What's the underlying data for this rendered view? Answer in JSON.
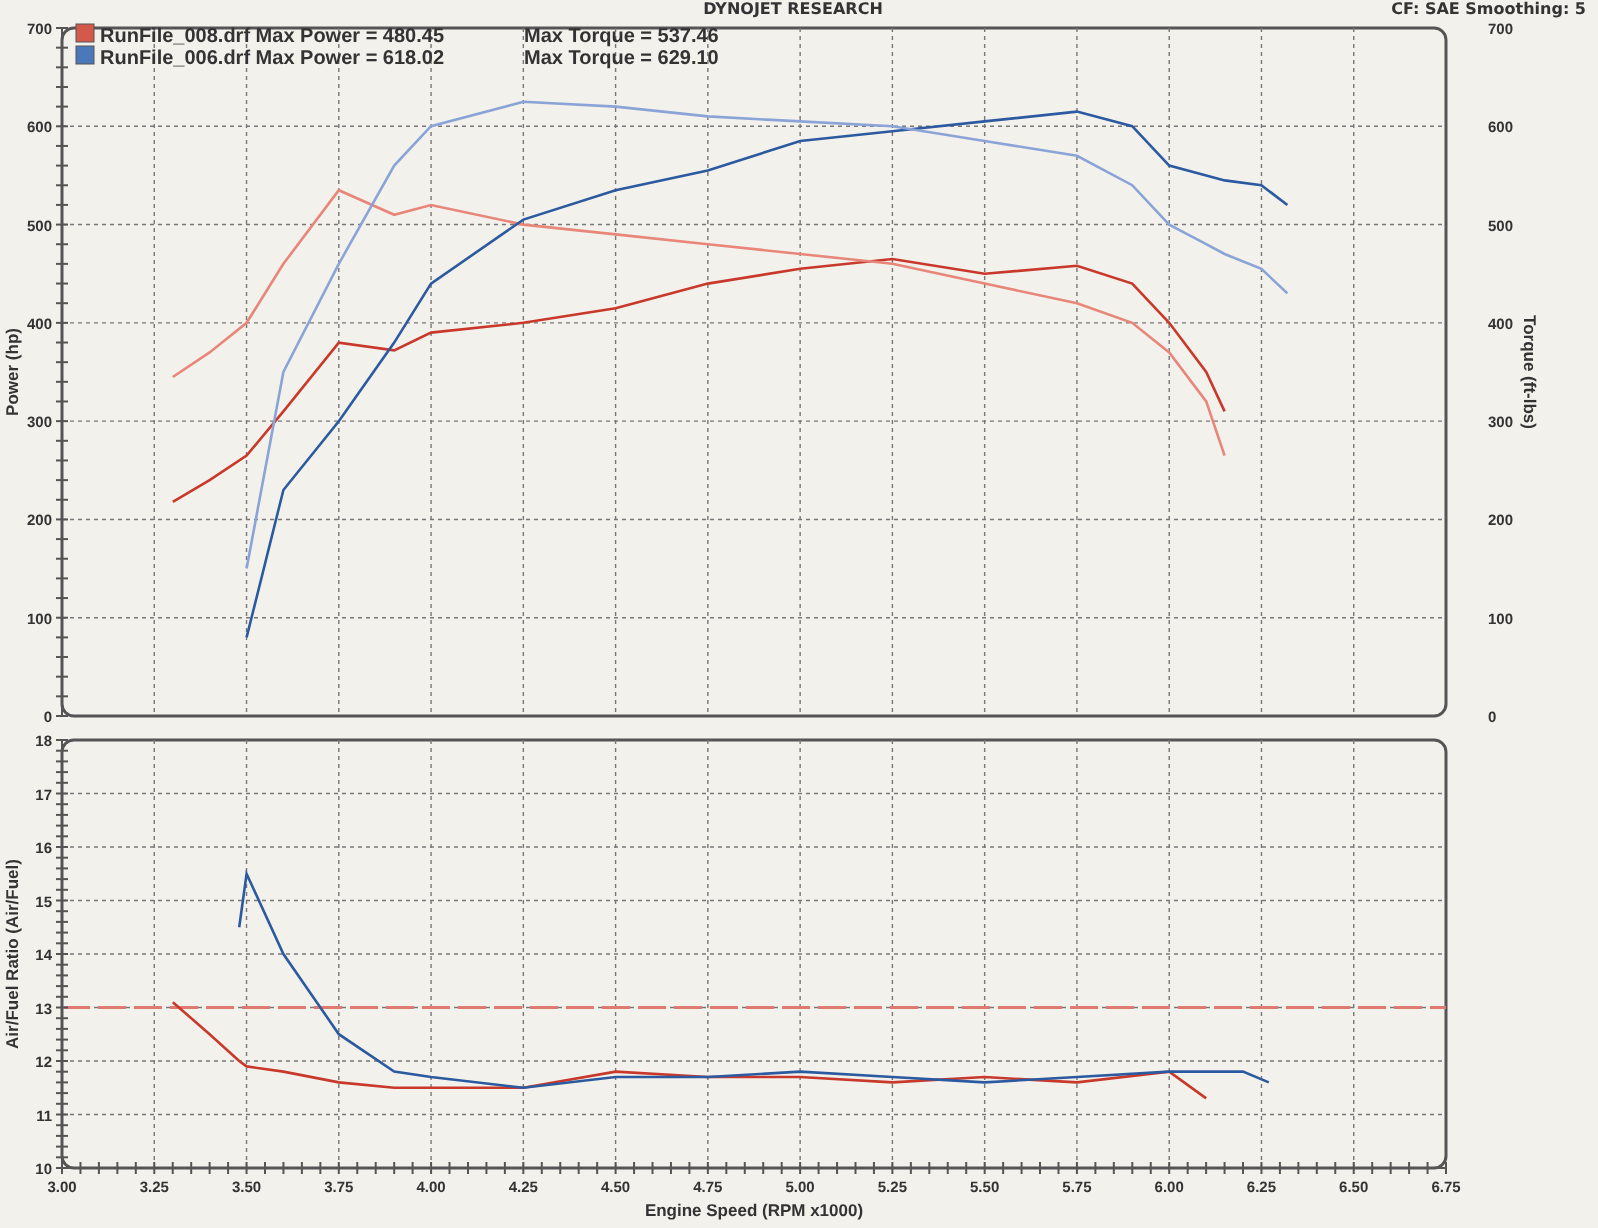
{
  "header": {
    "title": "DYNOJET RESEARCH",
    "settings": "CF: SAE  Smoothing: 5"
  },
  "legend": [
    {
      "run": "RunFile_008.drf Max Power = 480.45",
      "torque": "Max Torque = 537.46",
      "color": "#d4594a"
    },
    {
      "run": "RunFile_006.drf Max Power = 618.02",
      "torque": "Max Torque = 629.10",
      "color": "#4a78b8"
    }
  ],
  "power_chart": {
    "chart_data": {
      "type": "line",
      "grid": true,
      "ylabel": "Power (hp)",
      "y2label": "Torque (ft-lbs)",
      "xlim": [
        3,
        6.75
      ],
      "ylim": [
        0,
        700
      ],
      "y2lim": [
        0,
        700
      ],
      "yticks": [
        0,
        100,
        200,
        300,
        400,
        500,
        600,
        700
      ],
      "y2ticks": [
        0,
        100,
        200,
        300,
        400,
        500,
        600,
        700
      ],
      "x": [
        3.3,
        3.4,
        3.5,
        3.6,
        3.75,
        3.9,
        4.0,
        4.25,
        4.5,
        4.75,
        5.0,
        5.25,
        5.5,
        5.75,
        5.9,
        6.0,
        6.1,
        6.15,
        6.25,
        6.32
      ],
      "series": [
        {
          "color": "#c8392b",
          "values": [
            218,
            240,
            265,
            310,
            380,
            372,
            390,
            400,
            415,
            440,
            455,
            465,
            450,
            458,
            440,
            400,
            350,
            310,
            null,
            null
          ]
        },
        {
          "color": "#e8867a",
          "values": [
            345,
            370,
            400,
            460,
            535,
            510,
            520,
            500,
            490,
            480,
            470,
            460,
            440,
            420,
            400,
            370,
            320,
            265,
            null,
            null
          ]
        },
        {
          "color": "#2c5aa0",
          "values": [
            null,
            null,
            80,
            230,
            300,
            380,
            440,
            505,
            535,
            555,
            585,
            595,
            605,
            615,
            600,
            560,
            550,
            545,
            540,
            520
          ]
        },
        {
          "color": "#8aa4d8",
          "values": [
            null,
            null,
            150,
            350,
            460,
            560,
            600,
            625,
            620,
            610,
            605,
            600,
            585,
            570,
            540,
            500,
            480,
            470,
            455,
            430
          ]
        }
      ]
    }
  },
  "afr_chart": {
    "chart_data": {
      "type": "line",
      "grid": true,
      "ylabel": "Air/Fuel Ratio (Air/Fuel)",
      "xlabel": "Engine Speed (RPM x1000)",
      "xlim": [
        3,
        6.75
      ],
      "ylim": [
        10,
        18
      ],
      "yticks": [
        10,
        11,
        12,
        13,
        14,
        15,
        16,
        17,
        18
      ],
      "xticks": [
        {
          "value": 3,
          "label": "3.00"
        },
        {
          "value": 3.25,
          "label": "3.25"
        },
        {
          "value": 3.5,
          "label": "3.50"
        },
        {
          "value": 3.75,
          "label": "3.75"
        },
        {
          "value": 4,
          "label": "4.00"
        },
        {
          "value": 4.25,
          "label": "4.25"
        },
        {
          "value": 4.5,
          "label": "4.50"
        },
        {
          "value": 4.75,
          "label": "4.75"
        },
        {
          "value": 5,
          "label": "5.00"
        },
        {
          "value": 5.25,
          "label": "5.25"
        },
        {
          "value": 5.5,
          "label": "5.50"
        },
        {
          "value": 5.75,
          "label": "5.75"
        },
        {
          "value": 6,
          "label": "6.00"
        },
        {
          "value": 6.25,
          "label": "6.25"
        },
        {
          "value": 6.5,
          "label": "6.50"
        },
        {
          "value": 6.75,
          "label": "6.75"
        }
      ],
      "x": [
        3.3,
        3.4,
        3.48,
        3.5,
        3.6,
        3.75,
        3.9,
        4.0,
        4.25,
        4.5,
        4.75,
        5.0,
        5.25,
        5.5,
        5.75,
        6.0,
        6.1,
        6.2,
        6.27
      ],
      "series": [
        {
          "color": "#c8392b",
          "values": [
            13.1,
            12.5,
            12.0,
            11.9,
            11.8,
            11.6,
            11.5,
            11.5,
            11.5,
            11.8,
            11.7,
            11.7,
            11.6,
            11.7,
            11.6,
            11.8,
            11.3,
            null,
            null
          ]
        },
        {
          "color": "#2c5aa0",
          "values": [
            null,
            null,
            14.5,
            15.5,
            14.0,
            12.5,
            11.8,
            11.7,
            11.5,
            11.7,
            11.7,
            11.8,
            11.7,
            11.6,
            11.7,
            11.8,
            11.8,
            11.8,
            11.6
          ]
        }
      ],
      "ref_lines": [
        {
          "axis": "y",
          "value": 13,
          "color": "#e07a70"
        }
      ]
    }
  }
}
